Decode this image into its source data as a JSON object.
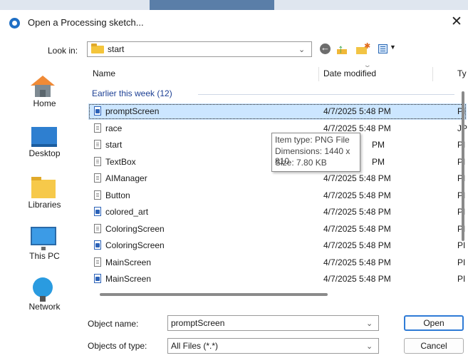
{
  "window": {
    "title": "Open a Processing sketch...",
    "close_glyph": "✕"
  },
  "lookin": {
    "label": "Look in:",
    "value": "start"
  },
  "toolbar": {
    "back_icon": "back-circle-icon",
    "up_icon": "up-folder-icon",
    "new_icon": "new-folder-icon",
    "view_icon": "view-menu-icon"
  },
  "places": [
    {
      "label": "Home",
      "icon": "home-icon"
    },
    {
      "label": "Desktop",
      "icon": "desktop-icon"
    },
    {
      "label": "Libraries",
      "icon": "libraries-icon"
    },
    {
      "label": "This PC",
      "icon": "this-pc-icon"
    },
    {
      "label": "Network",
      "icon": "network-icon"
    }
  ],
  "list": {
    "columns": {
      "name": "Name",
      "date": "Date modified",
      "type": "Ty"
    },
    "group_label": "Earlier this week (12)",
    "rows": [
      {
        "name": "promptScreen",
        "date": "4/7/2025 5:48 PM",
        "type": "PI",
        "icon": "image-file-icon",
        "selected": true
      },
      {
        "name": "race",
        "date": "4/7/2025 5:48 PM",
        "type": "JP",
        "icon": "text-file-icon"
      },
      {
        "name": "start",
        "date": "PM",
        "type": "PI",
        "icon": "text-file-icon"
      },
      {
        "name": "TextBox",
        "date": "PM",
        "type": "PI",
        "icon": "text-file-icon"
      },
      {
        "name": "AIManager",
        "date": "4/7/2025 5:48 PM",
        "type": "PI",
        "icon": "text-file-icon"
      },
      {
        "name": "Button",
        "date": "4/7/2025 5:48 PM",
        "type": "PI",
        "icon": "text-file-icon"
      },
      {
        "name": "colored_art",
        "date": "4/7/2025 5:48 PM",
        "type": "PI",
        "icon": "image-file-icon"
      },
      {
        "name": "ColoringScreen",
        "date": "4/7/2025 5:48 PM",
        "type": "PI",
        "icon": "text-file-icon"
      },
      {
        "name": "ColoringScreen",
        "date": "4/7/2025 5:48 PM",
        "type": "PI",
        "icon": "image-file-icon"
      },
      {
        "name": "MainScreen",
        "date": "4/7/2025 5:48 PM",
        "type": "PI",
        "icon": "text-file-icon"
      },
      {
        "name": "MainScreen",
        "date": "4/7/2025 5:48 PM",
        "type": "PI",
        "icon": "image-file-icon"
      }
    ]
  },
  "tooltip": {
    "item_type": "Item type: PNG File",
    "dimensions": "Dimensions: 1440 x 810",
    "size": "Size: 7.80 KB"
  },
  "object_name": {
    "label": "Object name:",
    "value": "promptScreen"
  },
  "objects_of_type": {
    "label": "Objects of type:",
    "value": "All Files (*.*)"
  },
  "buttons": {
    "open": "Open",
    "cancel": "Cancel"
  },
  "colors": {
    "accent": "#2f7bd6",
    "selection": "#cce6ff",
    "group_text": "#1c3f94"
  }
}
